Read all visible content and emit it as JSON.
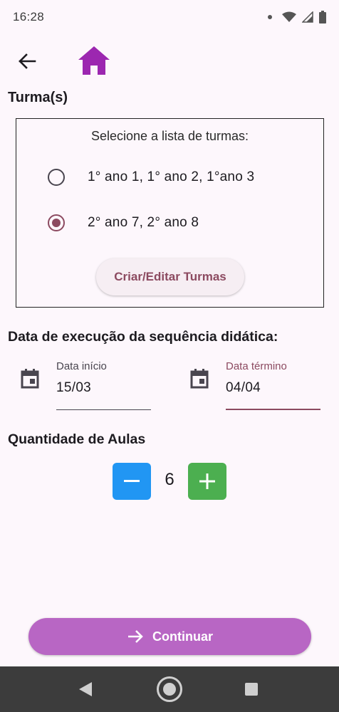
{
  "status_bar": {
    "time": "16:28",
    "icons": [
      "notification-dot-icon",
      "wifi-icon",
      "signal-icon",
      "battery-icon"
    ]
  },
  "app_bar": {
    "back_icon": "arrow-back-icon",
    "home_icon": "home-icon",
    "home_color": "#9c27b0"
  },
  "turmas": {
    "title": "Turma(s)",
    "prompt": "Selecione a lista de turmas:",
    "options": [
      {
        "label": "1° ano 1, 1° ano 2, 1°ano 3",
        "selected": false
      },
      {
        "label": "2° ano 7, 2° ano 8",
        "selected": true
      }
    ],
    "edit_button_label": "Criar/Editar Turmas"
  },
  "dates": {
    "title": "Data de execução da sequência didática:",
    "start": {
      "label": "Data início",
      "value": "15/03"
    },
    "end": {
      "label": "Data término",
      "value": "04/04",
      "focused": true
    }
  },
  "quantity": {
    "title": "Quantidade de Aulas",
    "value": "6",
    "minus_color": "#2196f3",
    "plus_color": "#4caf50"
  },
  "continue_button": {
    "label": "Continuar",
    "icon": "arrow-forward-icon",
    "color": "#b866c4"
  },
  "colors": {
    "accent": "#8c4a60",
    "background": "#fdf7fc"
  }
}
